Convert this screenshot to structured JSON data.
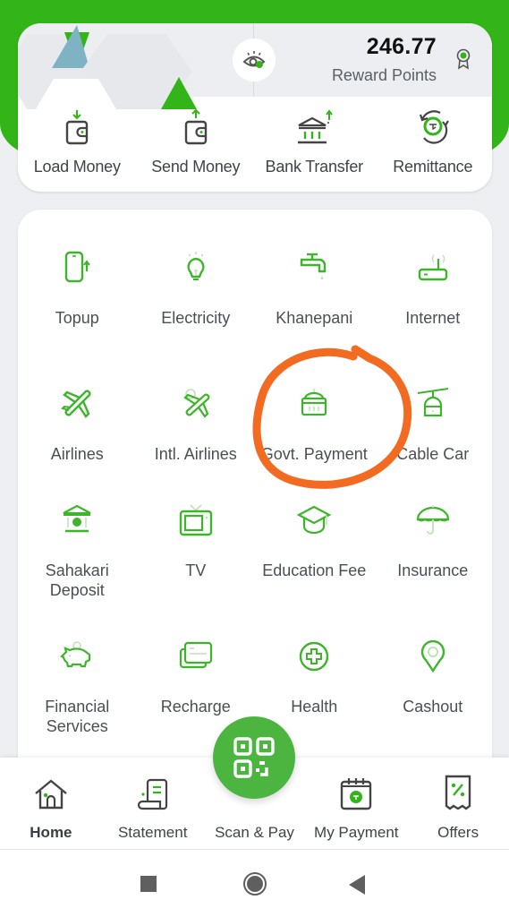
{
  "balance": {
    "reward_points_value": "246.77",
    "reward_points_label": "Reward Points",
    "visibility_toggle": "eye-icon"
  },
  "quick_actions": [
    {
      "label": "Load Money",
      "icon": "wallet-download-icon"
    },
    {
      "label": "Send Money",
      "icon": "wallet-upload-icon"
    },
    {
      "label": "Bank Transfer",
      "icon": "bank-icon"
    },
    {
      "label": "Remittance",
      "icon": "remittance-icon"
    }
  ],
  "services": [
    {
      "label": "Topup",
      "icon": "phone-topup-icon"
    },
    {
      "label": "Electricity",
      "icon": "bulb-icon"
    },
    {
      "label": "Khanepani",
      "icon": "water-tap-icon"
    },
    {
      "label": "Internet",
      "icon": "router-icon"
    },
    {
      "label": "Airlines",
      "icon": "airplane-icon"
    },
    {
      "label": "Intl. Airlines",
      "icon": "intl-airplane-icon"
    },
    {
      "label": "Govt. Payment",
      "icon": "government-building-icon"
    },
    {
      "label": "Cable Car",
      "icon": "cable-car-icon"
    },
    {
      "label": "Sahakari\nDeposit",
      "icon": "cooperative-icon"
    },
    {
      "label": "TV",
      "icon": "tv-icon"
    },
    {
      "label": "Education Fee",
      "icon": "graduation-cap-icon"
    },
    {
      "label": "Insurance",
      "icon": "umbrella-icon"
    },
    {
      "label": "Financial\nServices",
      "icon": "piggy-bank-icon"
    },
    {
      "label": "Recharge",
      "icon": "recharge-card-icon"
    },
    {
      "label": "Health",
      "icon": "health-plus-icon"
    },
    {
      "label": "Cashout",
      "icon": "location-pin-icon"
    }
  ],
  "annotation": {
    "highlighted_item": "Govt. Payment",
    "color": "#f26b21"
  },
  "bottom_nav": [
    {
      "label": "Home",
      "icon": "home-icon",
      "active": true
    },
    {
      "label": "Statement",
      "icon": "statement-icon"
    },
    {
      "label": "Scan & Pay",
      "icon": "qr-code-icon"
    },
    {
      "label": "My Payment",
      "icon": "calendar-payment-icon"
    },
    {
      "label": "Offers",
      "icon": "offers-receipt-icon"
    }
  ],
  "colors": {
    "brand_green": "#33b51a",
    "icon_green": "#3db52a",
    "text": "#4a4e55"
  }
}
